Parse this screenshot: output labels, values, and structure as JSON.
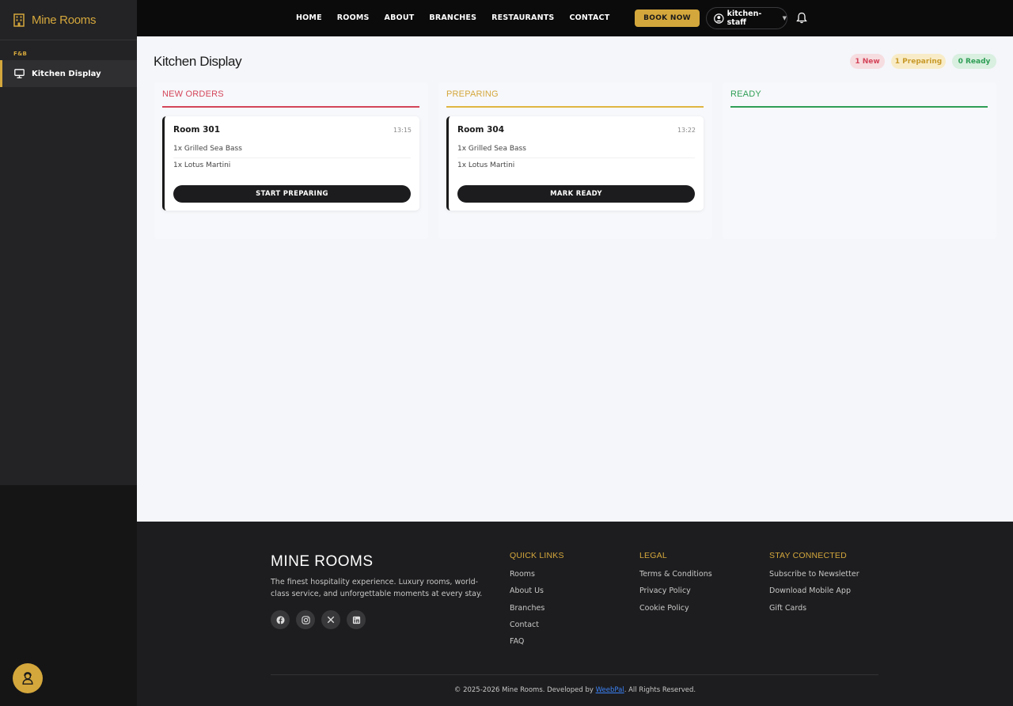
{
  "app": {
    "name": "Mine Rooms"
  },
  "sidebar": {
    "section": "F&B",
    "items": [
      {
        "label": "Kitchen Display",
        "icon": "monitor-icon",
        "active": true
      }
    ]
  },
  "topbar": {
    "nav": [
      "HOME",
      "ROOMS",
      "ABOUT",
      "BRANCHES",
      "RESTAURANTS",
      "CONTACT"
    ],
    "book_label": "BOOK NOW",
    "user": "kitchen-staff"
  },
  "page": {
    "title": "Kitchen Display",
    "counts": {
      "new": "1 New",
      "preparing": "1 Preparing",
      "ready": "0 Ready"
    }
  },
  "columns": [
    {
      "title": "NEW ORDERS",
      "color": "#d4455a",
      "orders": [
        {
          "room": "Room 301",
          "time": "13:15",
          "items": [
            "1x Grilled Sea Bass",
            "1x Lotus Martini"
          ],
          "action": "START PREPARING"
        }
      ]
    },
    {
      "title": "PREPARING",
      "color": "#d4a73c",
      "orders": [
        {
          "room": "Room 304",
          "time": "13:22",
          "items": [
            "1x Grilled Sea Bass",
            "1x Lotus Martini"
          ],
          "action": "MARK READY"
        }
      ]
    },
    {
      "title": "READY",
      "color": "#2e9e55",
      "orders": []
    }
  ],
  "footer": {
    "brand": "MINE ROOMS",
    "description": "The finest hospitality experience. Luxury rooms, world-class service, and unforgettable moments at every stay.",
    "socials": [
      "facebook-icon",
      "instagram-icon",
      "x-icon",
      "linkedin-icon"
    ],
    "quick_links": {
      "title": "QUICK LINKS",
      "links": [
        "Rooms",
        "About Us",
        "Branches",
        "Contact",
        "FAQ"
      ]
    },
    "legal": {
      "title": "LEGAL",
      "links": [
        "Terms & Conditions",
        "Privacy Policy",
        "Cookie Policy"
      ]
    },
    "stay_connected": {
      "title": "STAY CONNECTED",
      "links": [
        "Subscribe to Newsletter",
        "Download Mobile App",
        "Gift Cards"
      ]
    },
    "copyright_pre": "© 2025-2026 Mine Rooms. Developed by ",
    "developer": "WeebPal",
    "copyright_post": ". All Rights Reserved."
  },
  "colors": {
    "accent": "#d4a73c",
    "new": "#d4455a",
    "ready": "#2e9e55"
  }
}
